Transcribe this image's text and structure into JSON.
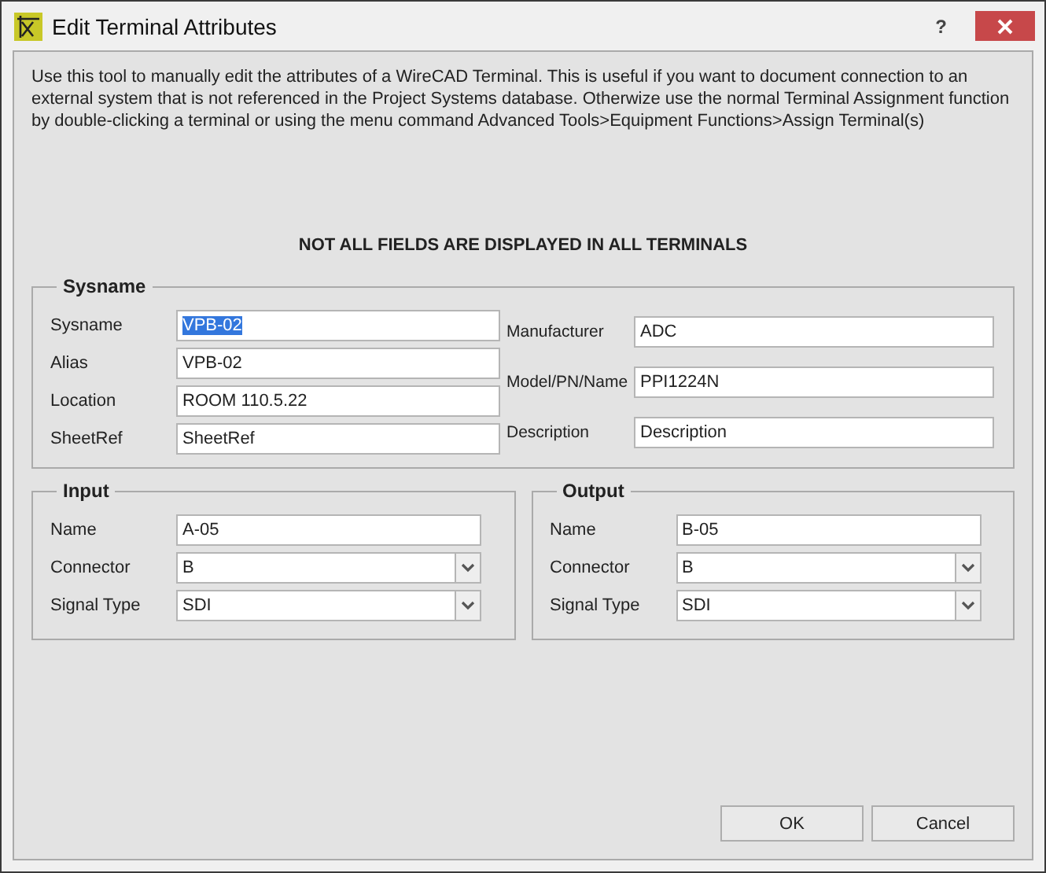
{
  "window": {
    "title": "Edit Terminal Attributes",
    "help": "?"
  },
  "description": "Use this tool to manually edit the attributes of a WireCAD Terminal. This is useful if you want to document connection to an external system that is not referenced in the Project Systems database. Otherwize use the normal Terminal Assignment function by double-clicking a terminal or using the menu command Advanced Tools>Equipment Functions>Assign Terminal(s)",
  "notice": "NOT ALL FIELDS ARE DISPLAYED IN ALL TERMINALS",
  "sysname_group": {
    "title": "Sysname",
    "left_fields": [
      {
        "label": "Sysname",
        "kind": "text",
        "value": "VPB-02",
        "text_selected": true
      },
      {
        "label": "Alias",
        "kind": "text",
        "value": "VPB-02",
        "text_selected": false
      },
      {
        "label": "Location",
        "kind": "text",
        "value": "ROOM 110.5.22",
        "text_selected": false
      },
      {
        "label": "SheetRef",
        "kind": "text",
        "value": "SheetRef",
        "text_selected": false
      }
    ],
    "right_fields": [
      {
        "label": "Manufacturer",
        "kind": "text",
        "value": "ADC",
        "text_selected": false
      },
      {
        "label": "Model/PN/Name",
        "kind": "text",
        "value": "PPI1224N",
        "text_selected": false
      },
      {
        "label": "Description",
        "kind": "text",
        "value": "Description",
        "text_selected": false
      }
    ]
  },
  "input_group": {
    "title": "Input",
    "fields": [
      {
        "label": "Name",
        "kind": "text",
        "value": "A-05",
        "text_selected": false
      },
      {
        "label": "Connector",
        "kind": "dropdown",
        "value": "B",
        "text_selected": false
      },
      {
        "label": "Signal Type",
        "kind": "dropdown",
        "value": "SDI",
        "text_selected": false
      }
    ]
  },
  "output_group": {
    "title": "Output",
    "fields": [
      {
        "label": "Name",
        "kind": "text",
        "value": "B-05",
        "text_selected": false
      },
      {
        "label": "Connector",
        "kind": "dropdown",
        "value": "B",
        "text_selected": false
      },
      {
        "label": "Signal Type",
        "kind": "dropdown",
        "value": "SDI",
        "text_selected": false
      }
    ]
  },
  "buttons": [
    "OK",
    "Cancel"
  ]
}
